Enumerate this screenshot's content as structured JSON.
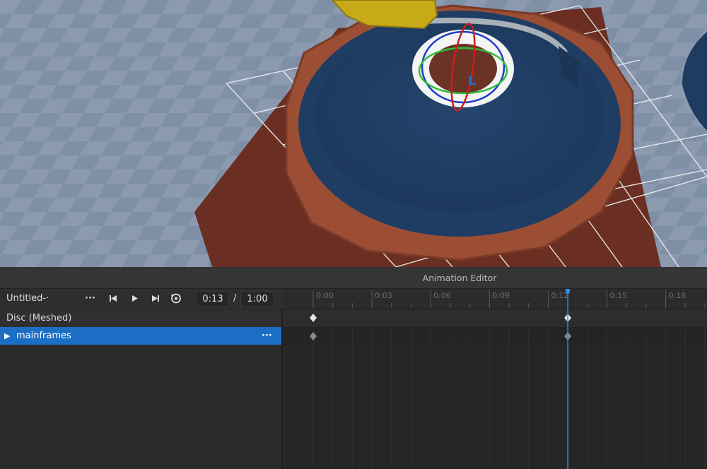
{
  "editor": {
    "title": "Animation Editor",
    "animation_name": "Untitled-·",
    "more_label": "···",
    "current_time": "0:13",
    "separator": "/",
    "end_time": "1:00"
  },
  "tracks": [
    {
      "label": "Disc (Meshed)"
    },
    {
      "label": "mainframes",
      "more": "···"
    }
  ],
  "timeline": {
    "ticks": [
      "0:00",
      "0:03",
      "0:06",
      "0:09",
      "0:12",
      "0:15",
      "0:18"
    ],
    "playhead_time_seconds": 13,
    "keyframes_seconds": [
      0,
      13
    ]
  },
  "viewport": {
    "gizmo_label": "L"
  },
  "colors": {
    "selection": "#1b6ec4",
    "playhead": "#2e8ae6"
  }
}
